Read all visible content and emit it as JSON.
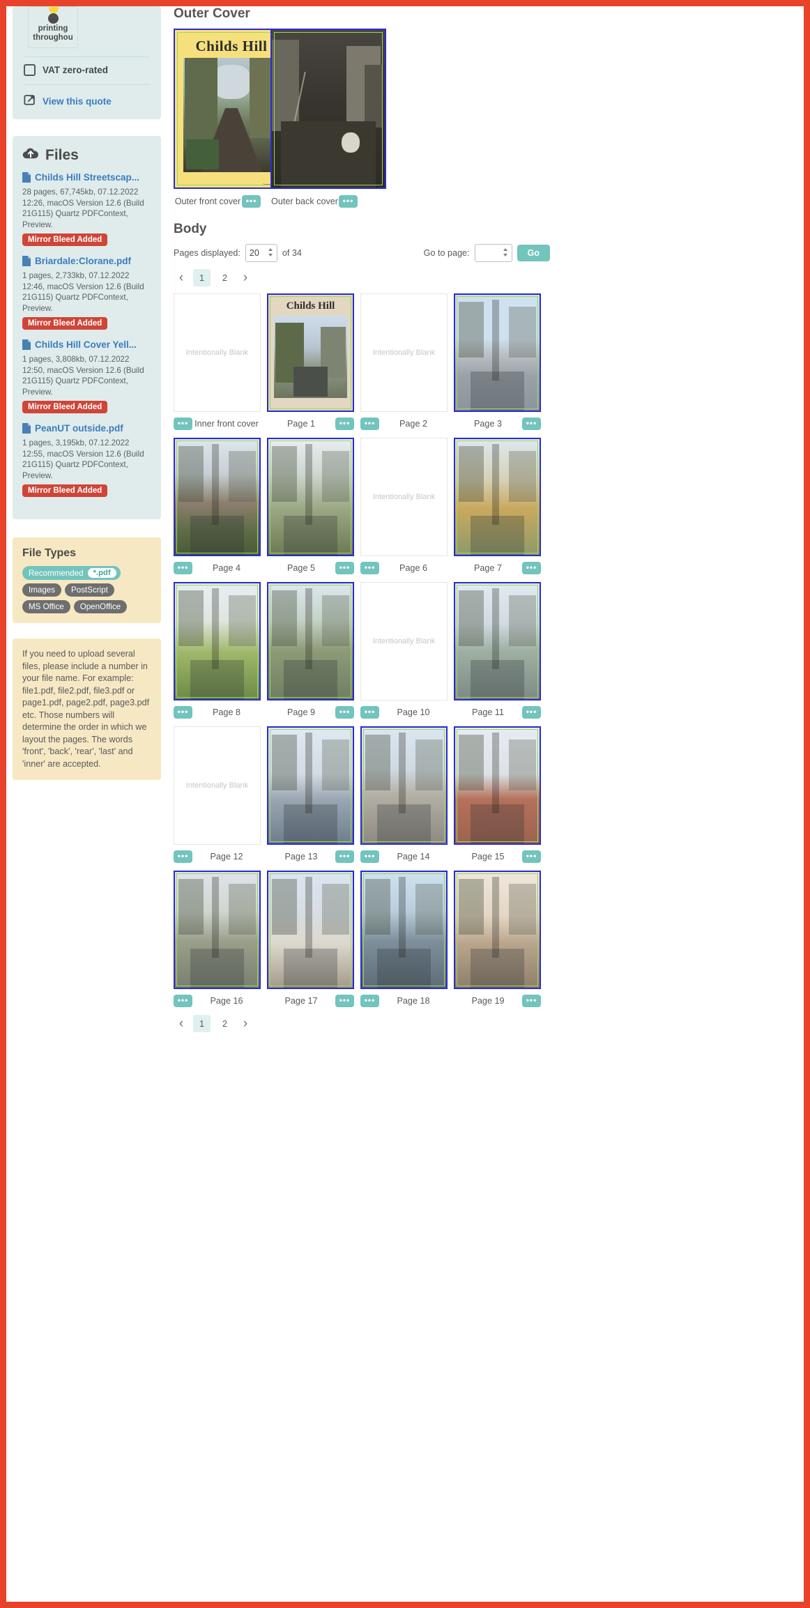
{
  "sidebar": {
    "print_thumb": {
      "label": "printing\nthroughou",
      "line1": "printing",
      "line2": "throughou"
    },
    "vat_checkbox_label": "VAT zero-rated",
    "view_quote_label": "View this quote",
    "files": {
      "title": "Files",
      "icon": "cloud-upload-icon",
      "items": [
        {
          "name": "Childs Hill Streetscap...",
          "meta": "28 pages, 67,745kb, 07.12.2022 12:26, macOS Version 12.6 (Build 21G115) Quartz PDFContext, Preview.",
          "badge": "Mirror Bleed Added"
        },
        {
          "name": "Briardale:Clorane.pdf",
          "meta": "1 pages, 2,733kb, 07.12.2022 12:46, macOS Version 12.6 (Build 21G115) Quartz PDFContext, Preview.",
          "badge": "Mirror Bleed Added"
        },
        {
          "name": "Childs Hill Cover Yell...",
          "meta": "1 pages, 3,808kb, 07.12.2022 12:50, macOS Version 12.6 (Build 21G115) Quartz PDFContext, Preview.",
          "badge": "Mirror Bleed Added"
        },
        {
          "name": "PeanUT outside.pdf",
          "meta": "1 pages, 3,195kb, 07.12.2022 12:55, macOS Version 12.6 (Build 21G115) Quartz PDFContext, Preview.",
          "badge": "Mirror Bleed Added"
        }
      ]
    },
    "file_types": {
      "title": "File Types",
      "recommended_label": "Recommended",
      "recommended_value": "*.pdf",
      "pills": [
        "Images",
        "PostScript",
        "MS Office",
        "OpenOffice"
      ]
    },
    "hint": "If you need to upload several files, please include a number in your file name. For example: file1.pdf, file2.pdf, file3.pdf or page1.pdf, page2.pdf, page3.pdf etc. Those numbers will determine the order in which we layout the pages. The words 'front', 'back', 'rear', 'last' and 'inner' are accepted."
  },
  "main": {
    "outer_cover": {
      "title": "Outer Cover",
      "items": [
        {
          "caption": "Outer front cover",
          "menu": "•••",
          "cover_title": "Childs Hill",
          "cover_credit": "Tasteful Printing Ltd"
        },
        {
          "caption": "Outer back cover",
          "menu": "•••"
        }
      ]
    },
    "body": {
      "title": "Body",
      "pages_displayed_label": "Pages displayed:",
      "pages_displayed_value": "20",
      "of_label": "of 34",
      "goto_label": "Go to page:",
      "goto_value": "",
      "go_button": "Go",
      "pager": {
        "prev": "‹",
        "next": "›",
        "pages": [
          "1",
          "2"
        ],
        "active": "1"
      },
      "menu_glyph": "•••",
      "blank_label": "Intentionally Blank",
      "rows": [
        [
          {
            "caption": "Inner front cover",
            "type": "blank",
            "dots": "left"
          },
          {
            "caption": "Page 1",
            "type": "art",
            "art": "cover-mini",
            "dots": "right"
          },
          {
            "caption": "Page 2",
            "type": "blank",
            "dots": "left"
          },
          {
            "caption": "Page 3",
            "type": "art",
            "art": "street-wet",
            "dots": "right"
          }
        ],
        [
          {
            "caption": "Page 4",
            "type": "art",
            "art": "houses-bare",
            "dots": "left"
          },
          {
            "caption": "Page 5",
            "type": "art",
            "art": "big-tree",
            "dots": "right"
          },
          {
            "caption": "Page 6",
            "type": "blank",
            "dots": "left"
          },
          {
            "caption": "Page 7",
            "type": "art",
            "art": "autumn-tree",
            "dots": "right"
          }
        ],
        [
          {
            "caption": "Page 8",
            "type": "art",
            "art": "green-fence",
            "dots": "left"
          },
          {
            "caption": "Page 9",
            "type": "art",
            "art": "alley-cyclist",
            "dots": "right"
          },
          {
            "caption": "Page 10",
            "type": "blank",
            "dots": "left"
          },
          {
            "caption": "Page 11",
            "type": "art",
            "art": "birch-lane",
            "dots": "right"
          }
        ],
        [
          {
            "caption": "Page 12",
            "type": "blank",
            "dots": "left"
          },
          {
            "caption": "Page 13",
            "type": "art",
            "art": "road-trees",
            "dots": "right"
          },
          {
            "caption": "Page 14",
            "type": "art",
            "art": "high-street",
            "dots": "left"
          },
          {
            "caption": "Page 15",
            "type": "art",
            "art": "red-terrace",
            "dots": "right"
          }
        ],
        [
          {
            "caption": "Page 16",
            "type": "art",
            "art": "misty-road",
            "dots": "left"
          },
          {
            "caption": "Page 17",
            "type": "art",
            "art": "white-house",
            "dots": "right"
          },
          {
            "caption": "Page 18",
            "type": "art",
            "art": "blue-car-street",
            "dots": "left"
          },
          {
            "caption": "Page 19",
            "type": "art",
            "art": "sunset-lane",
            "dots": "right"
          }
        ]
      ]
    }
  },
  "colors": {
    "frame_red": "#e8432a",
    "panel_teal": "#dfeceb",
    "panel_cream": "#f7e8c4",
    "link_blue": "#3b7cbf",
    "badge_red": "#cf4538",
    "accent_teal": "#72c4bd",
    "art_border_blue": "#2a2ad0",
    "art_border_green": "#9bd94f"
  }
}
